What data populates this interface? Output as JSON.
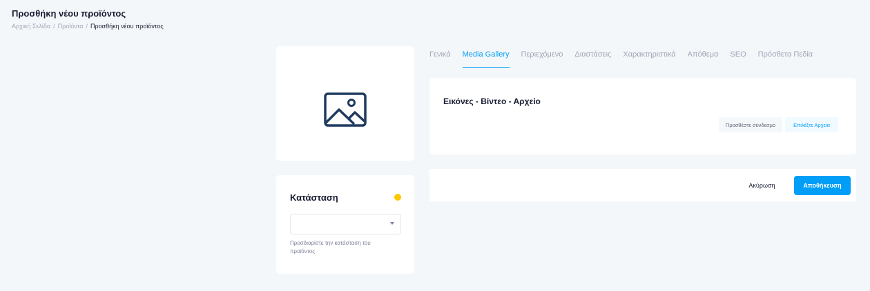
{
  "page": {
    "title": "Προσθήκη νέου προϊόντος"
  },
  "breadcrumb": {
    "home": "Αρχική Σελίδα",
    "sep1": "/",
    "products": "Προϊόντα",
    "sep2": "/",
    "current": "Προσθήκη νέου προϊόντος"
  },
  "thumbnail": {
    "icon": "image-placeholder-icon",
    "color": "#1e3a5f"
  },
  "status": {
    "title": "Κατάσταση",
    "dot_color": "#ffc700",
    "select_value": "",
    "help_text": "Προσδιορίστε την κατάσταση του προϊόντος"
  },
  "tabs": [
    {
      "label": "Γενικά",
      "active": false
    },
    {
      "label": "Media Gallery",
      "active": true
    },
    {
      "label": "Περιεχόμενο",
      "active": false
    },
    {
      "label": "Διαστάσεις",
      "active": false
    },
    {
      "label": "Χαρακτηριστικά",
      "active": false
    },
    {
      "label": "Απόθεμα",
      "active": false
    },
    {
      "label": "SEO",
      "active": false
    },
    {
      "label": "Πρόσθετα Πεδία",
      "active": false
    }
  ],
  "media": {
    "title": "Εικόνες - Βίντεο - Αρχείο",
    "add_link_label": "Προσθέστε σύνδεσμο",
    "choose_files_label": "Επιλέξτε Αρχεία"
  },
  "actions": {
    "cancel_label": "Ακύρωση",
    "save_label": "Αποθήκευση"
  },
  "colors": {
    "accent": "#009ef7",
    "background": "#f4f7fa"
  }
}
